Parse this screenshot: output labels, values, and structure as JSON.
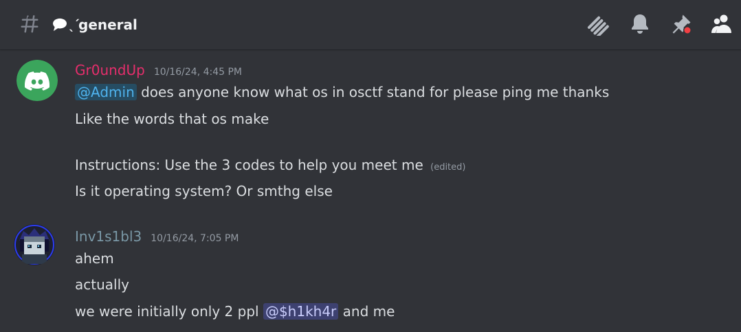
{
  "channel": {
    "name": "general",
    "prefix_emoji": "speech-bubble-icon",
    "prefix_deco": "ˎ´"
  },
  "header_icons": [
    "threads-icon",
    "bell-icon",
    "pin-icon",
    "members-icon"
  ],
  "colors": {
    "background": "#313338",
    "user1": "#e62e6c",
    "user2": "#7a98a6",
    "text": "#dbdee1",
    "muted": "#949ba4",
    "mention_badge_dot": "#f23f43"
  },
  "messages": [
    {
      "author": "Gr0undUp",
      "timestamp": "10/16/24, 4:45 PM",
      "lines": {
        "l1_mention": "@Admin",
        "l1_text": "does anyone know what os in osctf stand for please ping me thanks",
        "l2": "Like the words that os make",
        "l3": "Instructions: Use the 3 codes to help you meet me",
        "l3_edited": "(edited)",
        "l4": "Is it operating system? Or smthg else"
      }
    },
    {
      "author": "Inv1s1bl3",
      "timestamp": "10/16/24, 7:05 PM",
      "lines": {
        "l1": "ahem",
        "l2": "actually",
        "l3_text": "we were initially only 2 ppl",
        "l3_mention": "@$h1kh4r",
        "l3_after": "and me"
      }
    }
  ]
}
